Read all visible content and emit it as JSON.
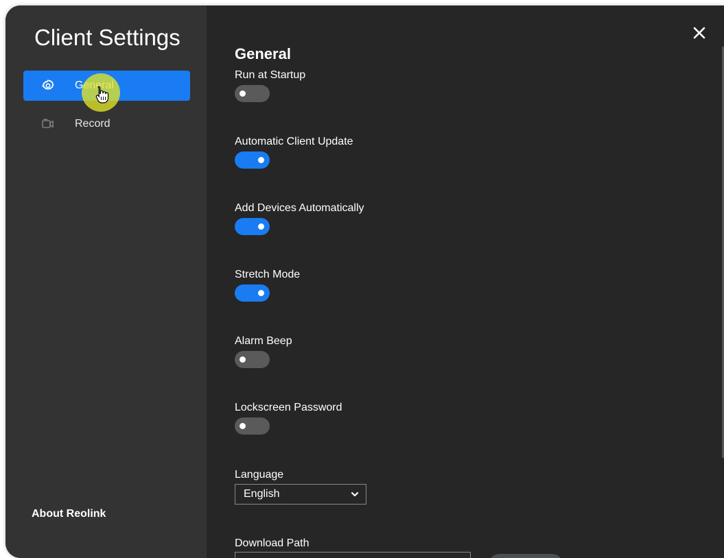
{
  "sidebar": {
    "title": "Client Settings",
    "items": [
      {
        "label": "General",
        "icon": "gear-icon",
        "active": true
      },
      {
        "label": "Record",
        "icon": "video-camera-icon",
        "active": false
      }
    ],
    "about_label": "About Reolink"
  },
  "main": {
    "section_title": "General",
    "settings": [
      {
        "label": "Run at Startup",
        "enabled": false
      },
      {
        "label": "Automatic Client Update",
        "enabled": true
      },
      {
        "label": "Add Devices Automatically",
        "enabled": true
      },
      {
        "label": "Stretch Mode",
        "enabled": true
      },
      {
        "label": "Alarm Beep",
        "enabled": false
      },
      {
        "label": "Lockscreen Password",
        "enabled": false
      }
    ],
    "language": {
      "label": "Language",
      "selected": "English"
    },
    "download_path": {
      "label": "Download Path",
      "value": ""
    }
  },
  "colors": {
    "accent": "#1a7cf2",
    "sidebar_bg": "#333333",
    "content_bg": "#262626",
    "toggle_off": "#5a5a5a",
    "cursor_highlight": "#e2e628"
  },
  "icons": {
    "close": "close-icon",
    "chevron": "chevron-down-icon",
    "cursor": "hand-pointer-icon"
  }
}
